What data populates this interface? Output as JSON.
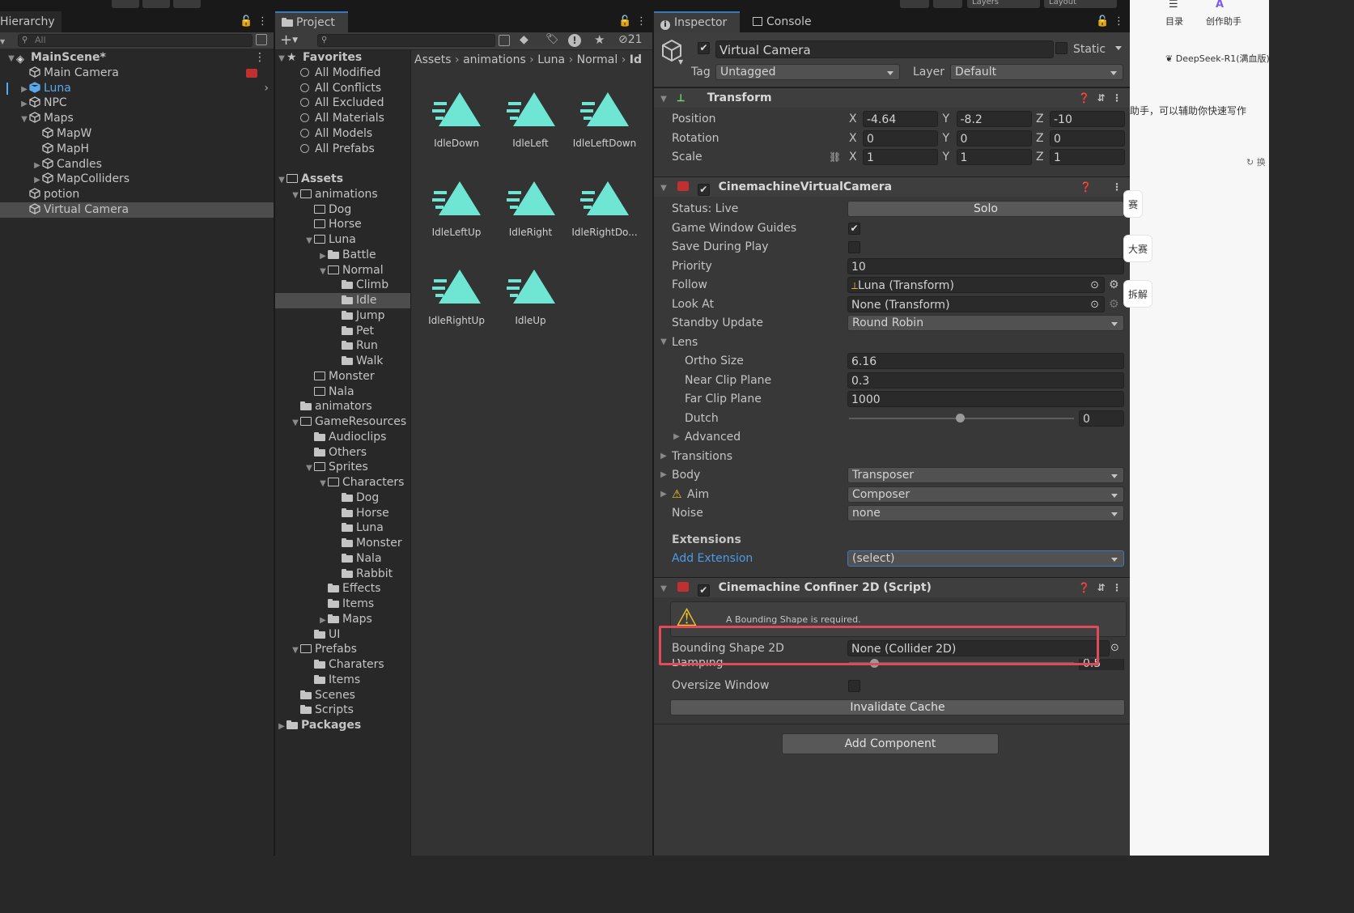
{
  "hierarchy": {
    "tab_label": "Hierarchy",
    "search_placeholder": "All",
    "rows": [
      {
        "label": "MainScene*",
        "indent": 1,
        "kind": "scene",
        "arrow": "down"
      },
      {
        "label": "Main Camera",
        "indent": 2,
        "kind": "cube"
      },
      {
        "label": "Luna",
        "indent": 2,
        "kind": "cube-blue",
        "arrow": "right",
        "accent": true
      },
      {
        "label": "NPC",
        "indent": 2,
        "kind": "cube",
        "arrow": "right"
      },
      {
        "label": "Maps",
        "indent": 2,
        "kind": "cube",
        "arrow": "down"
      },
      {
        "label": "MapW",
        "indent": 3,
        "kind": "cube"
      },
      {
        "label": "MapH",
        "indent": 3,
        "kind": "cube"
      },
      {
        "label": "Candles",
        "indent": 3,
        "kind": "cube",
        "arrow": "right"
      },
      {
        "label": "MapColliders",
        "indent": 3,
        "kind": "cube",
        "arrow": "right"
      },
      {
        "label": "potion",
        "indent": 2,
        "kind": "cube"
      },
      {
        "label": "Virtual Camera",
        "indent": 2,
        "kind": "cube",
        "selected": true
      }
    ]
  },
  "project": {
    "tab_label": "Project",
    "add_label": "+",
    "hidden_count": "21",
    "breadcrumb": [
      "Assets",
      "animations",
      "Luna",
      "Normal",
      "Id"
    ],
    "tree": [
      {
        "label": "Favorites",
        "indent": 0,
        "kind": "star",
        "arrow": "down",
        "bold": true
      },
      {
        "label": "All Modified",
        "indent": 1,
        "kind": "search"
      },
      {
        "label": "All Conflicts",
        "indent": 1,
        "kind": "search"
      },
      {
        "label": "All Excluded",
        "indent": 1,
        "kind": "search"
      },
      {
        "label": "All Materials",
        "indent": 1,
        "kind": "search"
      },
      {
        "label": "All Models",
        "indent": 1,
        "kind": "search"
      },
      {
        "label": "All Prefabs",
        "indent": 1,
        "kind": "search"
      },
      {
        "label": "",
        "indent": 0,
        "kind": "spacer"
      },
      {
        "label": "Assets",
        "indent": 0,
        "kind": "folder-open",
        "arrow": "down",
        "bold": true
      },
      {
        "label": "animations",
        "indent": 1,
        "kind": "folder-open",
        "arrow": "down"
      },
      {
        "label": "Dog",
        "indent": 2,
        "kind": "folder-outline"
      },
      {
        "label": "Horse",
        "indent": 2,
        "kind": "folder-outline"
      },
      {
        "label": "Luna",
        "indent": 2,
        "kind": "folder-open",
        "arrow": "down"
      },
      {
        "label": "Battle",
        "indent": 3,
        "kind": "folder",
        "arrow": "right"
      },
      {
        "label": "Normal",
        "indent": 3,
        "kind": "folder-open",
        "arrow": "down"
      },
      {
        "label": "Climb",
        "indent": 4,
        "kind": "folder"
      },
      {
        "label": "Idle",
        "indent": 4,
        "kind": "folder",
        "selected": true
      },
      {
        "label": "Jump",
        "indent": 4,
        "kind": "folder"
      },
      {
        "label": "Pet",
        "indent": 4,
        "kind": "folder"
      },
      {
        "label": "Run",
        "indent": 4,
        "kind": "folder"
      },
      {
        "label": "Walk",
        "indent": 4,
        "kind": "folder"
      },
      {
        "label": "Monster",
        "indent": 2,
        "kind": "folder-outline"
      },
      {
        "label": "Nala",
        "indent": 2,
        "kind": "folder-outline"
      },
      {
        "label": "animators",
        "indent": 1,
        "kind": "folder"
      },
      {
        "label": "GameResources",
        "indent": 1,
        "kind": "folder-open",
        "arrow": "down"
      },
      {
        "label": "Audioclips",
        "indent": 2,
        "kind": "folder"
      },
      {
        "label": "Others",
        "indent": 2,
        "kind": "folder"
      },
      {
        "label": "Sprites",
        "indent": 2,
        "kind": "folder-open",
        "arrow": "down"
      },
      {
        "label": "Characters",
        "indent": 3,
        "kind": "folder-open",
        "arrow": "down"
      },
      {
        "label": "Dog",
        "indent": 4,
        "kind": "folder"
      },
      {
        "label": "Horse",
        "indent": 4,
        "kind": "folder"
      },
      {
        "label": "Luna",
        "indent": 4,
        "kind": "folder"
      },
      {
        "label": "Monster",
        "indent": 4,
        "kind": "folder"
      },
      {
        "label": "Nala",
        "indent": 4,
        "kind": "folder"
      },
      {
        "label": "Rabbit",
        "indent": 4,
        "kind": "folder"
      },
      {
        "label": "Effects",
        "indent": 3,
        "kind": "folder"
      },
      {
        "label": "Items",
        "indent": 3,
        "kind": "folder"
      },
      {
        "label": "Maps",
        "indent": 3,
        "kind": "folder",
        "arrow": "right"
      },
      {
        "label": "UI",
        "indent": 2,
        "kind": "folder"
      },
      {
        "label": "Prefabs",
        "indent": 1,
        "kind": "folder-open",
        "arrow": "down"
      },
      {
        "label": "Charaters",
        "indent": 2,
        "kind": "folder"
      },
      {
        "label": "Items",
        "indent": 2,
        "kind": "folder"
      },
      {
        "label": "Scenes",
        "indent": 1,
        "kind": "folder"
      },
      {
        "label": "Scripts",
        "indent": 1,
        "kind": "folder"
      },
      {
        "label": "Packages",
        "indent": 0,
        "kind": "folder",
        "arrow": "right",
        "bold": true
      }
    ],
    "assets": [
      "IdleDown",
      "IdleLeft",
      "IdleLeftDown",
      "IdleLeftUp",
      "IdleRight",
      "IdleRightDo...",
      "IdleRightUp",
      "IdleUp"
    ],
    "asset_color": "#6fe6d3"
  },
  "inspector": {
    "tab_label": "Inspector",
    "console_label": "Console",
    "object_name": "Virtual Camera",
    "static_label": "Static",
    "tag_label": "Tag",
    "tag_value": "Untagged",
    "layer_label": "Layer",
    "layer_value": "Default",
    "transform": {
      "title": "Transform",
      "position_label": "Position",
      "rotation_label": "Rotation",
      "scale_label": "Scale",
      "x": "X",
      "y": "Y",
      "z": "Z",
      "position": [
        "-4.64",
        "-8.2",
        "-10"
      ],
      "rotation": [
        "0",
        "0",
        "0"
      ],
      "scale": [
        "1",
        "1",
        "1"
      ]
    },
    "vcam": {
      "title": "CinemachineVirtualCamera",
      "status_label": "Status: Live",
      "solo_label": "Solo",
      "guides_label": "Game Window Guides",
      "save_label": "Save During Play",
      "priority_label": "Priority",
      "priority_value": "10",
      "follow_label": "Follow",
      "follow_value": "Luna (Transform)",
      "lookat_label": "Look At",
      "lookat_value": "None (Transform)",
      "standby_label": "Standby Update",
      "standby_value": "Round Robin",
      "lens_label": "Lens",
      "ortho_label": "Ortho Size",
      "ortho_value": "6.16",
      "near_label": "Near Clip Plane",
      "near_value": "0.3",
      "far_label": "Far Clip Plane",
      "far_value": "1000",
      "dutch_label": "Dutch",
      "dutch_value": "0",
      "advanced_label": "Advanced",
      "transitions_label": "Transitions",
      "body_label": "Body",
      "body_value": "Transposer",
      "aim_label": "Aim",
      "aim_value": "Composer",
      "noise_label": "Noise",
      "noise_value": "none",
      "extensions_label": "Extensions",
      "add_extension_label": "Add Extension",
      "extension_value": "(select)"
    },
    "confiner": {
      "title": "Cinemachine Confiner 2D (Script)",
      "warning_text": "A Bounding Shape is required.",
      "bounding_label": "Bounding Shape 2D",
      "bounding_value": "None (Collider 2D)",
      "damping_label": "Damping",
      "damping_value": "0.5",
      "oversize_label": "Oversize Window",
      "invalidate_label": "Invalidate Cache"
    },
    "add_component_label": "Add Component",
    "highlight_color": "#e04b5a"
  },
  "topbar": {
    "layers_label": "Layers",
    "layout_label": "Layout"
  },
  "web_sidebar": {
    "toc_label": "目录",
    "assistant_label": "创作助手",
    "model_label": "DeepSeek-R1(满血版)",
    "hint_text": "助手，可以辅助你快速写作",
    "refresh_label": "换",
    "chips": [
      "赛",
      "大赛",
      "拆解"
    ]
  }
}
